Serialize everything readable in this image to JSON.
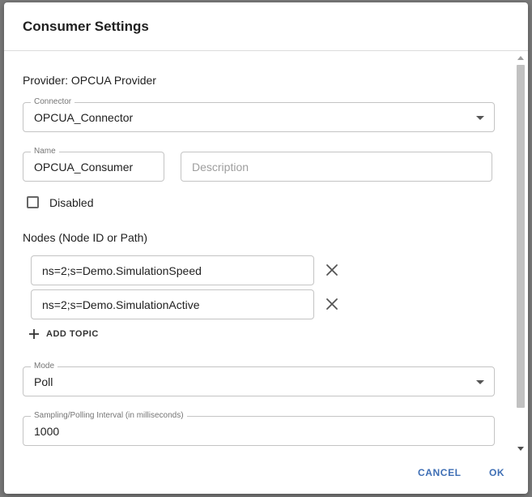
{
  "dialog": {
    "title": "Consumer Settings"
  },
  "provider_text": "Provider: OPCUA Provider",
  "connector": {
    "label": "Connector",
    "value": "OPCUA_Connector"
  },
  "name_field": {
    "label": "Name",
    "value": "OPCUA_Consumer"
  },
  "description_field": {
    "placeholder": "Description"
  },
  "disabled_checkbox": {
    "label": "Disabled",
    "checked": false
  },
  "nodes": {
    "heading": "Nodes (Node ID or Path)",
    "items": [
      {
        "value": "ns=2;s=Demo.SimulationSpeed"
      },
      {
        "value": "ns=2;s=Demo.SimulationActive"
      }
    ],
    "add_label": "ADD TOPIC"
  },
  "mode": {
    "label": "Mode",
    "value": "Poll"
  },
  "interval": {
    "label": "Sampling/Polling Interval (in milliseconds)",
    "value": "1000"
  },
  "footer": {
    "cancel_label": "CANCEL",
    "ok_label": "OK"
  },
  "icons": {
    "remove": "close-icon",
    "add": "plus-icon",
    "dropdown": "chevron-down-icon"
  },
  "colors": {
    "accent": "#3f6fb5",
    "overlay": "#7a7a7a"
  }
}
